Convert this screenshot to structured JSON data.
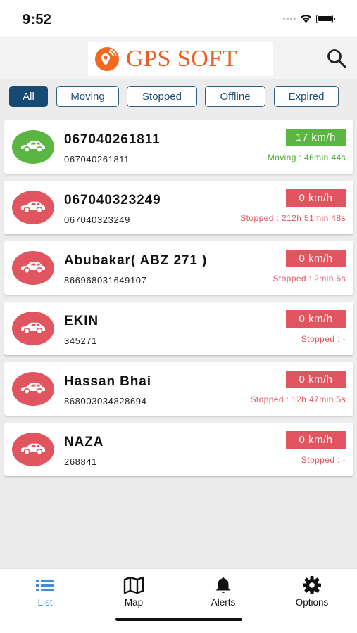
{
  "status_bar": {
    "time": "9:52"
  },
  "header": {
    "logo_text": "GPS SOFT"
  },
  "filters": [
    {
      "label": "All",
      "active": true
    },
    {
      "label": "Moving",
      "active": false
    },
    {
      "label": "Stopped",
      "active": false
    },
    {
      "label": "Offline",
      "active": false
    },
    {
      "label": "Expired",
      "active": false
    }
  ],
  "vehicles": [
    {
      "name": "067040261811",
      "id": "067040261811",
      "speed": "17 km/h",
      "state": "Moving : 46min 44s",
      "status": "moving"
    },
    {
      "name": "067040323249",
      "id": "067040323249",
      "speed": "0 km/h",
      "state": "Stopped : 212h 51min 48s",
      "status": "stopped"
    },
    {
      "name": "Abubakar( ABZ 271 )",
      "id": "866968031649107",
      "speed": "0 km/h",
      "state": "Stopped : 2min 6s",
      "status": "stopped"
    },
    {
      "name": "EKIN",
      "id": "345271",
      "speed": "0 km/h",
      "state": "Stopped : -",
      "status": "stopped"
    },
    {
      "name": "Hassan Bhai",
      "id": "868003034828694",
      "speed": "0 km/h",
      "state": "Stopped : 12h 47min 5s",
      "status": "stopped"
    },
    {
      "name": "NAZA",
      "id": "268841",
      "speed": "0 km/h",
      "state": "Stopped : -",
      "status": "stopped"
    }
  ],
  "tabs": [
    {
      "label": "List",
      "icon": "list-icon",
      "active": true
    },
    {
      "label": "Map",
      "icon": "map-icon",
      "active": false
    },
    {
      "label": "Alerts",
      "icon": "bell-icon",
      "active": false
    },
    {
      "label": "Options",
      "icon": "gear-icon",
      "active": false
    }
  ],
  "colors": {
    "moving": "#5bb542",
    "stopped": "#e0555f",
    "brand": "#f05a24",
    "filter_active": "#174a73",
    "tab_active": "#3f8ddf"
  }
}
